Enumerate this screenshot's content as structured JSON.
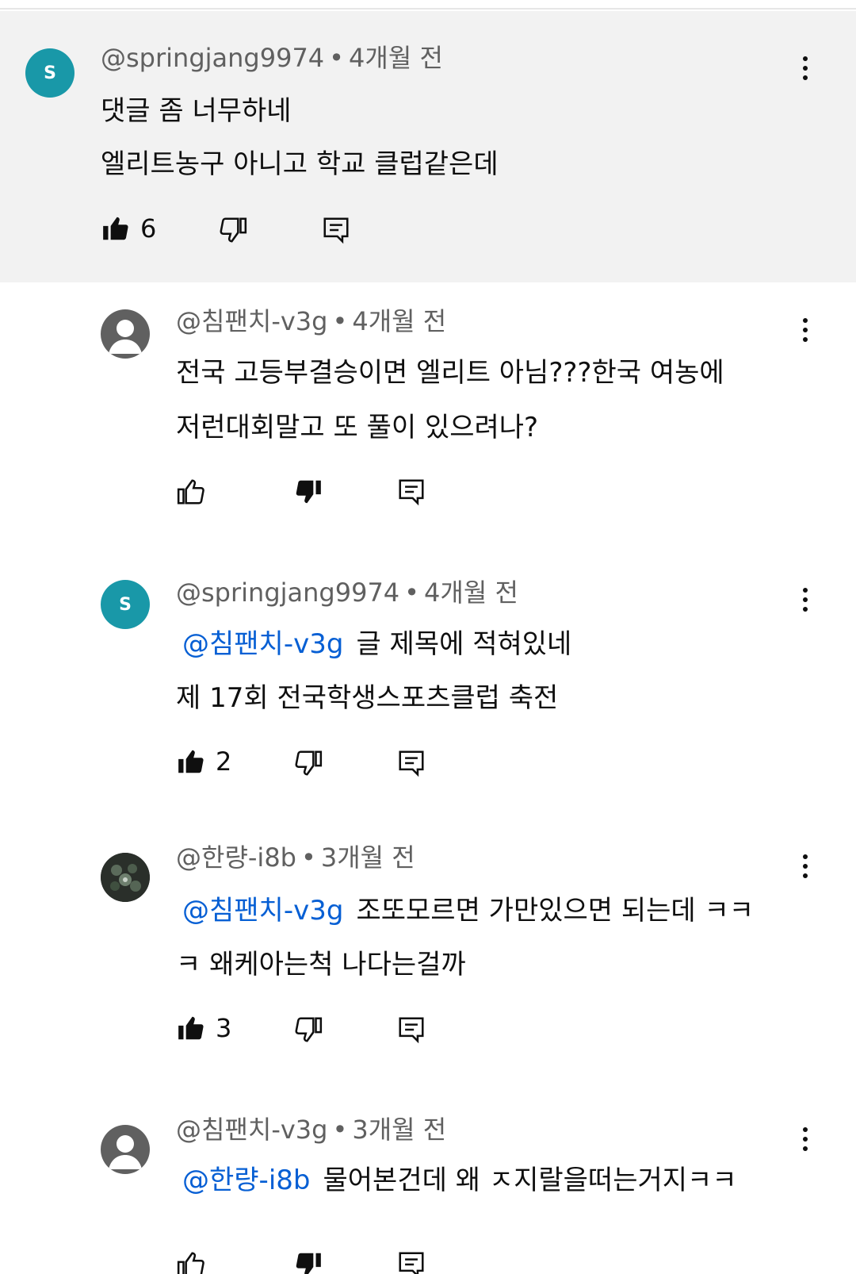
{
  "comments": [
    {
      "user": "@springjang9974",
      "time": "4개월 전",
      "avatar_letter": "S",
      "avatar_color": "#1998a8",
      "mention": "",
      "lines": [
        "댓글 좀 너무하네",
        "엘리트농구 아니고 학교 클럽같은데"
      ],
      "likes": "6",
      "liked": true,
      "disliked": false
    },
    {
      "user": "@침팬치-v3g",
      "time": "4개월 전",
      "avatar_letter": "",
      "avatar_color": "#606060",
      "mention": "",
      "lines": [
        "전국 고등부결승이면 엘리트 아님???한국 여농에",
        "저런대회말고 또 풀이 있으려나?"
      ],
      "likes": "",
      "liked": false,
      "disliked": true
    },
    {
      "user": "@springjang9974",
      "time": "4개월 전",
      "avatar_letter": "S",
      "avatar_color": "#1998a8",
      "mention": "@침팬치-v3g",
      "lines": [
        "글 제목에 적혀있네",
        "제 17회 전국학생스포츠클럽 축전"
      ],
      "likes": "2",
      "liked": true,
      "disliked": false
    },
    {
      "user": "@한량-i8b",
      "time": "3개월 전",
      "avatar_letter": "",
      "avatar_color": "#1a1a1a",
      "mention": "@침팬치-v3g",
      "lines": [
        "조또모르면 가만있으면 되는데 ㅋㅋ",
        "ㅋ 왜케아는척 나다는걸까"
      ],
      "likes": "3",
      "liked": true,
      "disliked": false
    },
    {
      "user": "@침팬치-v3g",
      "time": "3개월 전",
      "avatar_letter": "",
      "avatar_color": "#606060",
      "mention": "@한량-i8b",
      "lines": [
        "물어본건데 왜 ㅈ지랄을떠는거지ㅋㅋ"
      ],
      "likes": "",
      "liked": false,
      "disliked": true
    }
  ],
  "icons": {
    "like": "thumb-up-icon",
    "dislike": "thumb-down-icon",
    "reply": "reply-icon",
    "more": "more-vert-icon"
  }
}
